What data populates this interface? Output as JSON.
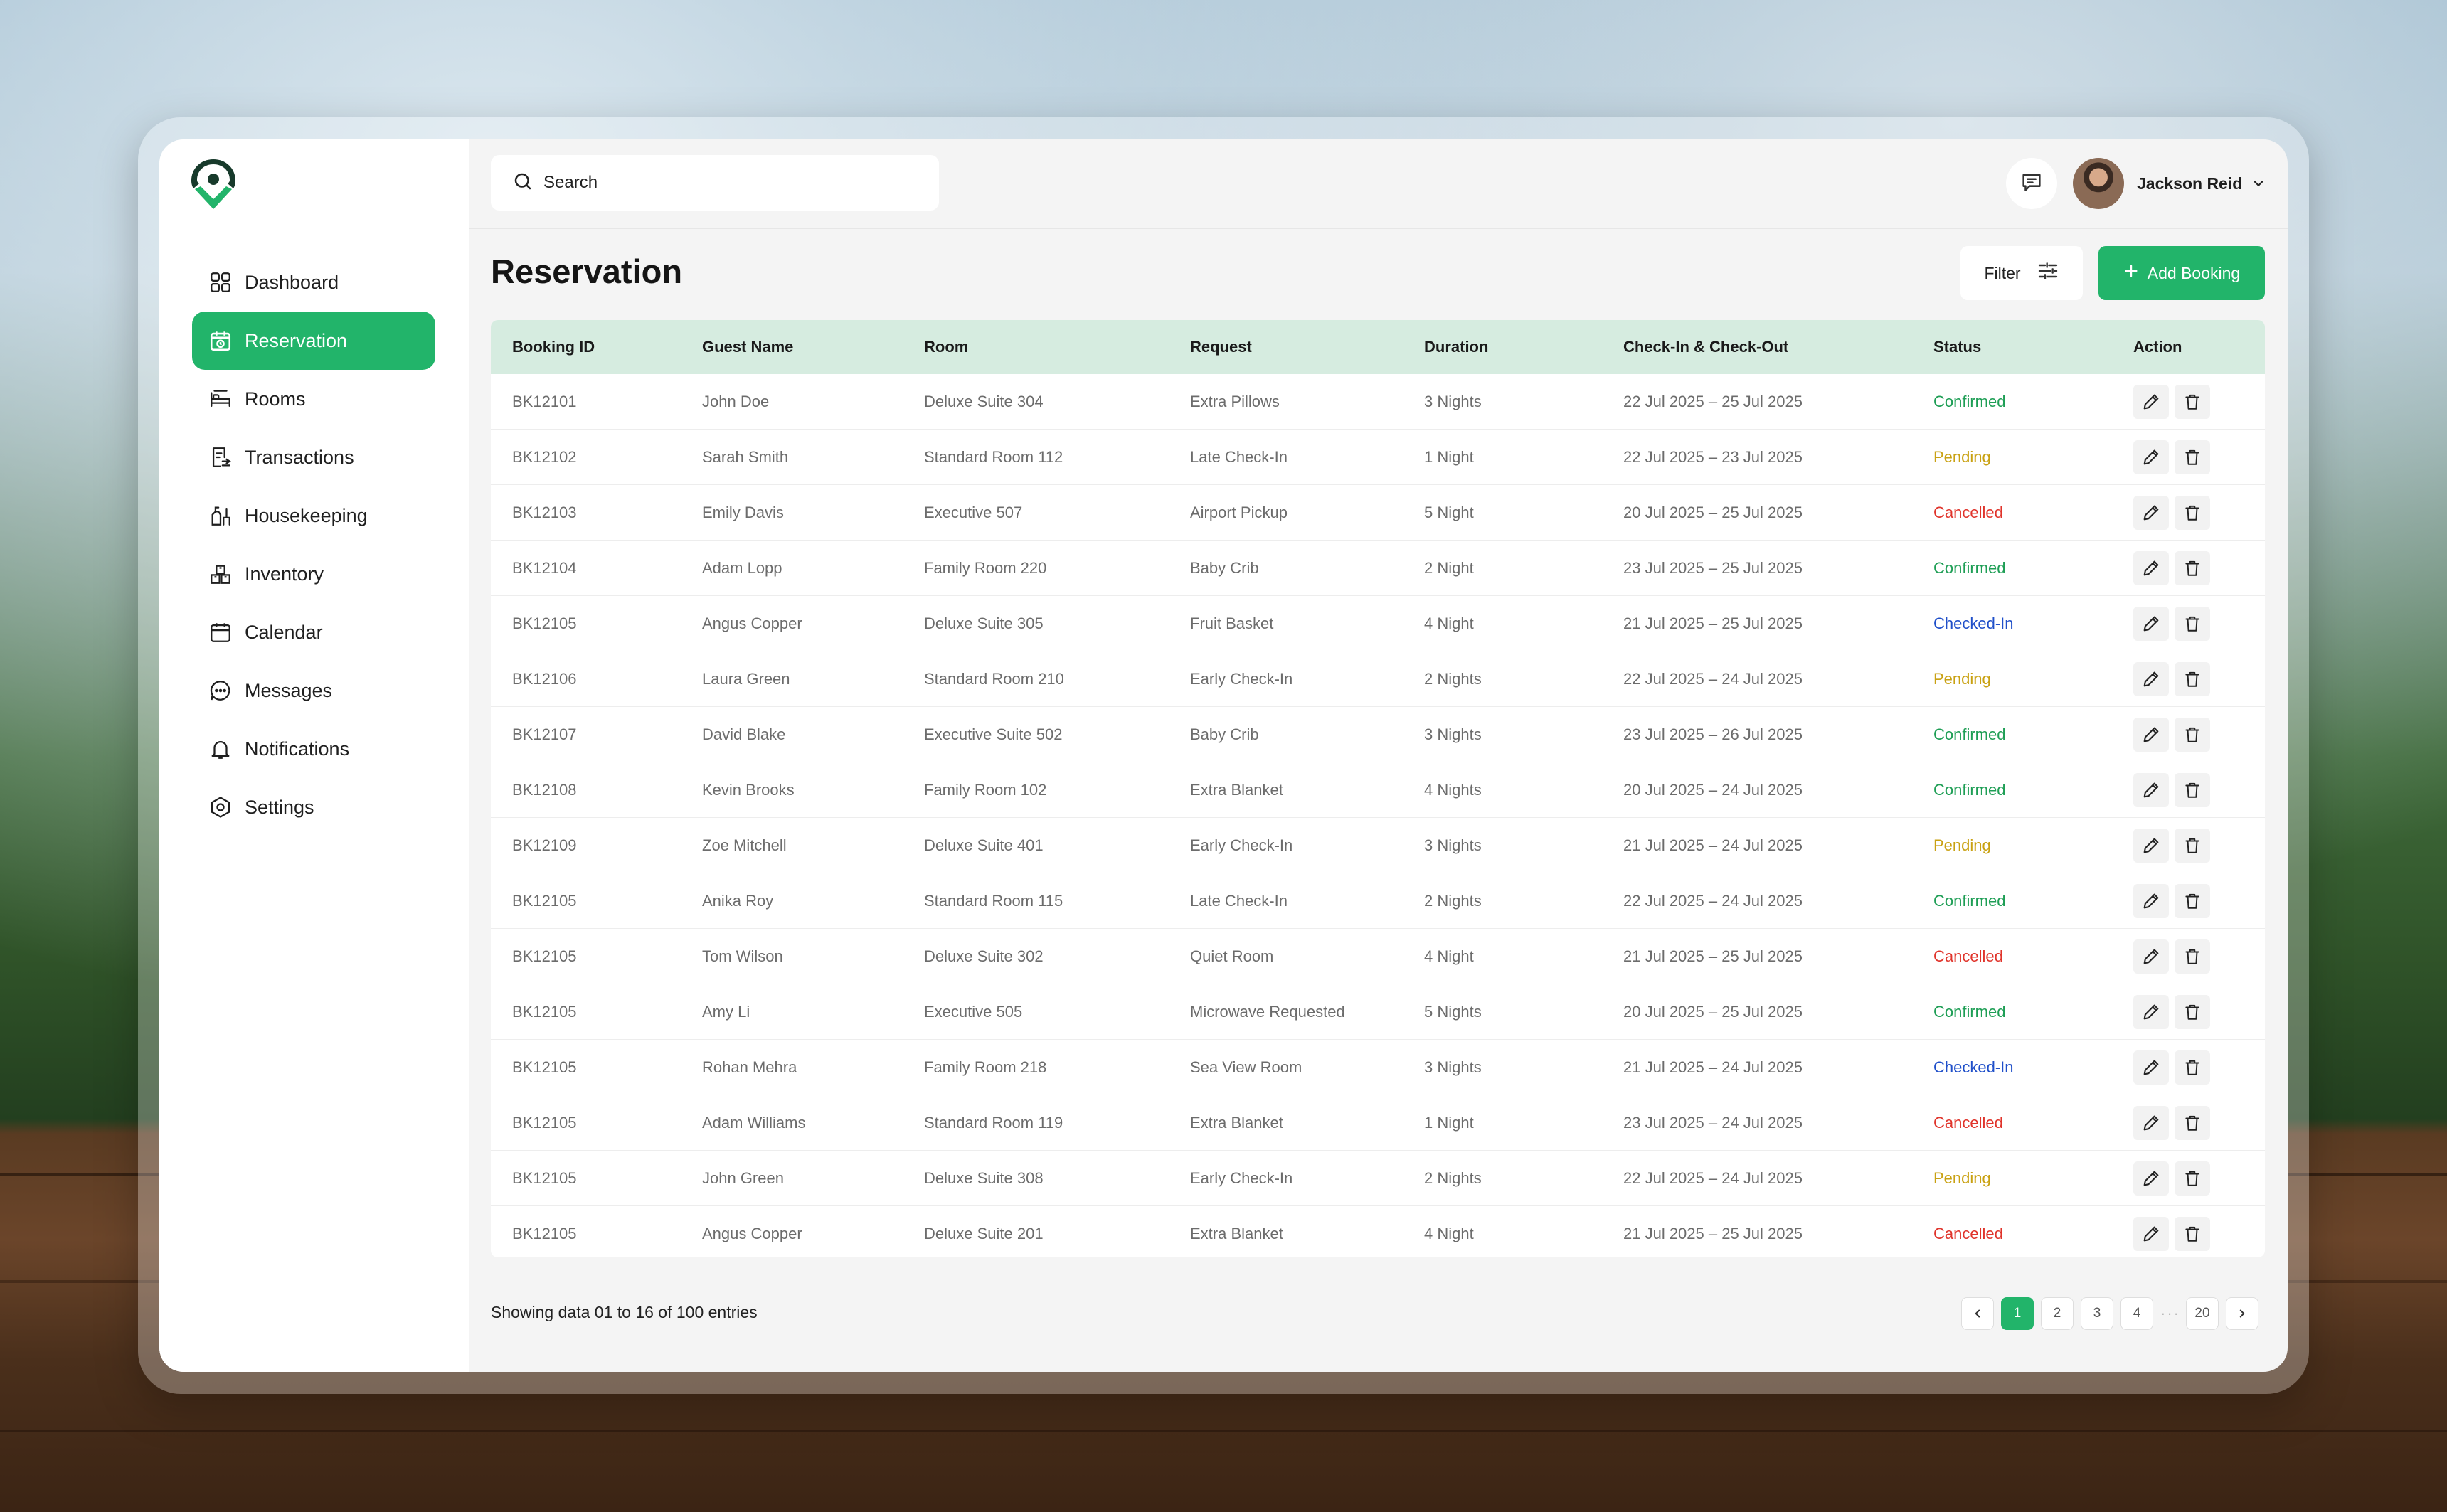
{
  "brand": {
    "accent": "#22b46a",
    "logo_icon": "map-pin-check-icon"
  },
  "sidebar": {
    "items": [
      {
        "label": "Dashboard",
        "icon": "grid-icon"
      },
      {
        "label": "Reservation",
        "icon": "calendar-clock-icon",
        "active": true
      },
      {
        "label": "Rooms",
        "icon": "bed-icon"
      },
      {
        "label": "Transactions",
        "icon": "receipt-icon"
      },
      {
        "label": "Housekeeping",
        "icon": "cleaning-icon"
      },
      {
        "label": "Inventory",
        "icon": "boxes-icon"
      },
      {
        "label": "Calendar",
        "icon": "calendar-icon"
      },
      {
        "label": "Messages",
        "icon": "chat-icon"
      },
      {
        "label": "Notifications",
        "icon": "bell-icon"
      },
      {
        "label": "Settings",
        "icon": "gear-icon"
      }
    ]
  },
  "header": {
    "search_placeholder": "Search",
    "user_name": "Jackson Reid"
  },
  "page": {
    "title": "Reservation",
    "filter_label": "Filter",
    "add_label": "Add Booking"
  },
  "table": {
    "columns": [
      "Booking ID",
      "Guest Name",
      "Room",
      "Request",
      "Duration",
      "Check-In & Check-Out",
      "Status",
      "Action"
    ],
    "rows": [
      {
        "id": "BK12101",
        "guest": "John Doe",
        "room": "Deluxe Suite 304",
        "request": "Extra Pillows",
        "duration": "3 Nights",
        "dates": "22 Jul 2025 – 25 Jul 2025",
        "status": "Confirmed"
      },
      {
        "id": "BK12102",
        "guest": "Sarah Smith",
        "room": "Standard Room 112",
        "request": "Late Check-In",
        "duration": "1 Night",
        "dates": "22 Jul 2025 – 23 Jul 2025",
        "status": "Pending"
      },
      {
        "id": "BK12103",
        "guest": "Emily Davis",
        "room": "Executive 507",
        "request": "Airport Pickup",
        "duration": "5 Night",
        "dates": "20 Jul 2025 – 25 Jul 2025",
        "status": "Cancelled"
      },
      {
        "id": "BK12104",
        "guest": "Adam Lopp",
        "room": "Family Room 220",
        "request": "Baby Crib",
        "duration": "2 Night",
        "dates": "23 Jul 2025 – 25 Jul 2025",
        "status": "Confirmed"
      },
      {
        "id": "BK12105",
        "guest": "Angus Copper",
        "room": "Deluxe Suite 305",
        "request": "Fruit Basket",
        "duration": "4 Night",
        "dates": "21 Jul 2025 – 25 Jul 2025",
        "status": "Checked-In"
      },
      {
        "id": "BK12106",
        "guest": "Laura Green",
        "room": "Standard Room 210",
        "request": "Early Check-In",
        "duration": "2 Nights",
        "dates": "22 Jul 2025 – 24 Jul 2025",
        "status": "Pending"
      },
      {
        "id": "BK12107",
        "guest": "David Blake",
        "room": "Executive Suite 502",
        "request": "Baby Crib",
        "duration": "3 Nights",
        "dates": "23 Jul 2025 – 26 Jul 2025",
        "status": "Confirmed"
      },
      {
        "id": "BK12108",
        "guest": "Kevin Brooks",
        "room": "Family Room 102",
        "request": "Extra Blanket",
        "duration": "4 Nights",
        "dates": "20 Jul 2025 – 24 Jul 2025",
        "status": "Confirmed"
      },
      {
        "id": "BK12109",
        "guest": "Zoe Mitchell",
        "room": "Deluxe Suite 401",
        "request": "Early Check-In",
        "duration": "3 Nights",
        "dates": "21 Jul 2025 – 24 Jul 2025",
        "status": "Pending"
      },
      {
        "id": "BK12105",
        "guest": "Anika Roy",
        "room": "Standard Room 115",
        "request": "Late Check-In",
        "duration": "2 Nights",
        "dates": "22 Jul 2025 – 24 Jul 2025",
        "status": "Confirmed"
      },
      {
        "id": "BK12105",
        "guest": "Tom Wilson",
        "room": "Deluxe Suite 302",
        "request": "Quiet Room",
        "duration": "4 Night",
        "dates": "21 Jul 2025 – 25 Jul 2025",
        "status": "Cancelled"
      },
      {
        "id": "BK12105",
        "guest": "Amy Li",
        "room": "Executive 505",
        "request": "Microwave Requested",
        "duration": "5 Nights",
        "dates": "20 Jul 2025 – 25 Jul 2025",
        "status": "Confirmed"
      },
      {
        "id": "BK12105",
        "guest": "Rohan Mehra",
        "room": "Family Room 218",
        "request": "Sea View Room",
        "duration": "3 Nights",
        "dates": "21 Jul 2025 – 24 Jul 2025",
        "status": "Checked-In"
      },
      {
        "id": "BK12105",
        "guest": "Adam Williams",
        "room": "Standard Room 119",
        "request": "Extra Blanket",
        "duration": "1 Night",
        "dates": "23 Jul 2025 – 24 Jul 2025",
        "status": "Cancelled"
      },
      {
        "id": "BK12105",
        "guest": "John Green",
        "room": "Deluxe Suite 308",
        "request": "Early Check-In",
        "duration": "2 Nights",
        "dates": "22 Jul 2025 – 24 Jul 2025",
        "status": "Pending"
      },
      {
        "id": "BK12105",
        "guest": "Angus Copper",
        "room": "Deluxe Suite 201",
        "request": "Extra Blanket",
        "duration": "4 Night",
        "dates": "21 Jul 2025 – 25 Jul 2025",
        "status": "Cancelled"
      }
    ]
  },
  "footer": {
    "showing_text": "Showing data 01 to 16 of  100 entries",
    "pages": [
      "1",
      "2",
      "3",
      "4"
    ],
    "last_page": "20",
    "current_page": "1"
  },
  "status_colors": {
    "Confirmed": "#1e9e55",
    "Pending": "#c9a112",
    "Cancelled": "#e0342b",
    "Checked-In": "#1f4fc9"
  }
}
